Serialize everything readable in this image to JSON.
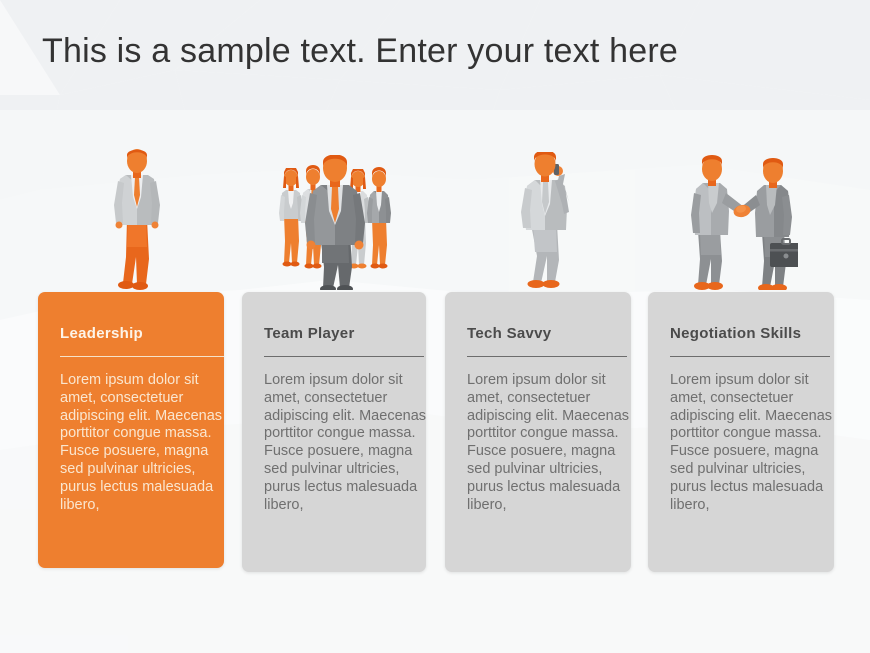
{
  "slide": {
    "title": "This is a sample text. Enter your text here",
    "background_color": "#f7f8f9",
    "title_color": "#333333",
    "accent_color": "#ee7f2f",
    "card_grey_color": "#d6d6d6"
  },
  "body_text": "Lorem ipsum dolor sit amet, consectetuer adipiscing elit. Maecenas porttitor congue massa. Fusce posuere, magna sed pulvinar ultricies, purus lectus malesuada libero,",
  "cards": [
    {
      "title": "Leadership",
      "body": "Lorem ipsum dolor sit amet, consectetuer adipiscing elit. Maecenas porttitor congue massa. Fusce posuere, magna sed pulvinar ultricies, purus lectus malesuada libero,",
      "style": "orange",
      "icon": "businessman-walking-icon"
    },
    {
      "title": "Team Player",
      "body": "Lorem ipsum dolor sit amet, consectetuer adipiscing elit. Maecenas porttitor congue massa. Fusce posuere, magna sed pulvinar ultricies, purus lectus malesuada libero,",
      "style": "grey",
      "icon": "business-team-group-icon"
    },
    {
      "title": "Tech Savvy",
      "body": "Lorem ipsum dolor sit amet, consectetuer adipiscing elit. Maecenas porttitor congue massa. Fusce posuere, magna sed pulvinar ultricies, purus lectus malesuada libero,",
      "style": "grey",
      "icon": "businessman-on-phone-icon"
    },
    {
      "title": "Negotiation  Skills",
      "body": "Lorem ipsum dolor sit amet, consectetuer adipiscing elit. Maecenas porttitor congue massa. Fusce posuere, magna sed pulvinar ultricies, purus lectus malesuada libero,",
      "style": "grey",
      "icon": "handshake-deal-icon"
    }
  ]
}
